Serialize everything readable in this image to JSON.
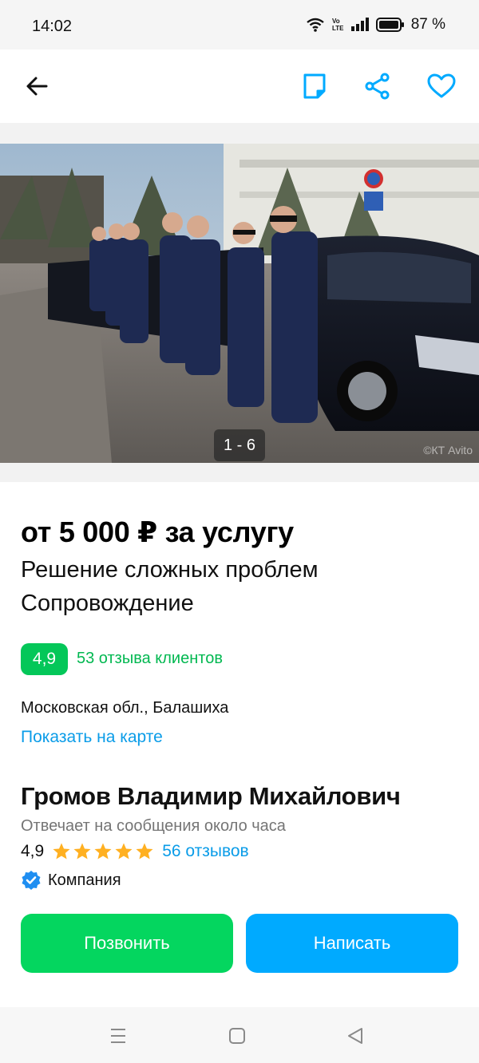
{
  "status_bar": {
    "time": "14:02",
    "battery": "87 %"
  },
  "header": {
    "icons": [
      "back-arrow-icon",
      "note-icon",
      "share-icon",
      "heart-icon"
    ]
  },
  "photo": {
    "counter": "1 - 6",
    "watermark": "©КТ Avito"
  },
  "listing": {
    "price": "от 5 000 ₽ за услугу",
    "title_line1": "Решение сложных проблем",
    "title_line2": "Сопровождение",
    "rating": "4,9",
    "reviews_link": "53 отзыва клиентов",
    "address": "Московская обл., Балашиха",
    "map_link": "Показать на карте"
  },
  "seller": {
    "name": "Громов Владимир Михайлович",
    "responds": "Отвечает на сообщения около часа",
    "rating": "4,9",
    "stars": 5,
    "reviews": "56 отзывов",
    "type": "Компания"
  },
  "actions": {
    "call_label": "Позвонить",
    "message_label": "Написать"
  },
  "colors": {
    "accent_blue": "#00aaff",
    "link_blue": "#0a9ce8",
    "green": "#04c759",
    "star": "#ffb021"
  }
}
